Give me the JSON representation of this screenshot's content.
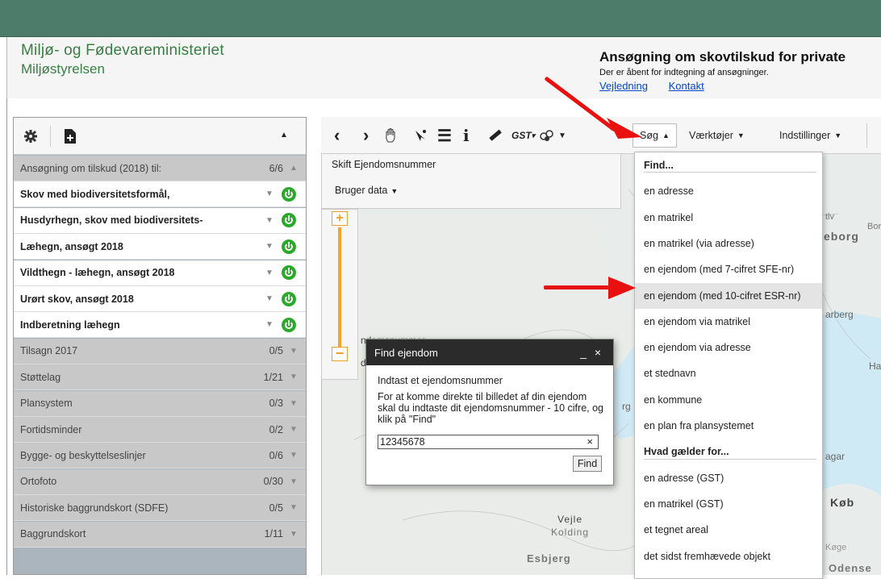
{
  "header": {
    "ministry": "Miljø- og Fødevareministeriet",
    "agency": "Miljøstyrelsen",
    "app_title": "Ansøgning om skovtilskud for private",
    "app_subtitle": "Der er åbent for indtegning af ansøgninger.",
    "links": [
      "Vejledning",
      "Kontakt"
    ]
  },
  "left_panel": {
    "toolbar_icons": [
      "gear-icon",
      "add-document-icon",
      "collapse-up-icon"
    ],
    "rows": [
      {
        "label": "Ansøgning om tilskud (2018) til:",
        "count": "6/6",
        "style": "grey",
        "arrow": "▲"
      },
      {
        "label": "Skov med biodiversitetsformål,",
        "style": "white",
        "arrow": "▼",
        "power": true
      },
      {
        "label": "Husdyrhegn, skov med biodiversitets-",
        "style": "white",
        "arrow": "▼",
        "power": true
      },
      {
        "label": "Læhegn, ansøgt 2018",
        "style": "white",
        "arrow": "▼",
        "power": true
      },
      {
        "label": "Vildthegn - læhegn, ansøgt 2018",
        "style": "white",
        "arrow": "▼",
        "power": true
      },
      {
        "label": "Urørt skov, ansøgt 2018",
        "style": "white",
        "arrow": "▼",
        "power": true
      },
      {
        "label": "Indberetning læhegn",
        "style": "white",
        "arrow": "▼",
        "power": true
      },
      {
        "label": "Tilsagn 2017",
        "count": "0/5",
        "style": "grey",
        "arrow": "▼"
      },
      {
        "label": "Støttelag",
        "count": "1/21",
        "style": "grey",
        "arrow": "▼"
      },
      {
        "label": "Plansystem",
        "count": "0/3",
        "style": "grey",
        "arrow": "▼"
      },
      {
        "label": "Fortidsminder",
        "count": "0/2",
        "style": "grey",
        "arrow": "▼"
      },
      {
        "label": "Bygge- og beskyttelseslinjer",
        "count": "0/6",
        "style": "grey",
        "arrow": "▼"
      },
      {
        "label": "Ortofoto",
        "count": "0/30",
        "style": "grey",
        "arrow": "▼"
      },
      {
        "label": "Historiske baggrundskort (SDFE)",
        "count": "0/5",
        "style": "grey",
        "arrow": "▼"
      },
      {
        "label": "Baggrundskort",
        "count": "1/11",
        "style": "grey",
        "arrow": "▼"
      }
    ]
  },
  "map_toolbar": {
    "gst_label": "GST",
    "search_label": "Søg",
    "tools_label": "Værktøjer",
    "settings_label": "Indstillinger"
  },
  "map_card": {
    "title": "Skift Ejendomsnummer",
    "user_data": "Bruger data"
  },
  "map_labels": {
    "vejle": "Vejle",
    "kolding": "Kolding",
    "esbjerg": "Esbjerg",
    "odense": "Odense",
    "koge": "Køge",
    "kob": "Køb",
    "arberg": "arberg",
    "eborg": "eborg",
    "partial_number": "ndomsnummer",
    "partial_d": "d",
    "partial_tlv": "tlv",
    "partial_bor": "Bor",
    "partial_ha": "Ha",
    "partial_rg": "rg",
    "partial_agar": "agar"
  },
  "search_menu": {
    "find_header": "Find...",
    "find_items": [
      "en adresse",
      "en matrikel",
      "en matrikel (via adresse)",
      "en ejendom (med 7-cifret SFE-nr)",
      "en ejendom (med 10-cifret ESR-nr)",
      "en ejendom via matrikel",
      "en ejendom via adresse",
      "et stednavn",
      "en kommune",
      "en plan fra plansystemet"
    ],
    "highlighted_index": 4,
    "applies_header": "Hvad gælder for...",
    "applies_items": [
      "en adresse (GST)",
      "en matrikel (GST)",
      "et tegnet areal",
      "det sidst fremhævede objekt"
    ]
  },
  "dialog": {
    "title": "Find ejendom",
    "controls": "_ ×",
    "heading": "Indtast et ejendomsnummer",
    "text": "For at komme direkte til billedet af din ejendom skal du indtaste dit ejendomsnummer - 10 cifre, og klik på \"Find\"",
    "input_value": "12345678",
    "clear": "×",
    "button": "Find"
  },
  "colors": {
    "topbar": "#4e7c6a",
    "brand_green": "#3a7d44",
    "power_green": "#2aa92a",
    "arrow_red": "#e8110f",
    "link_blue": "#0645c8"
  }
}
